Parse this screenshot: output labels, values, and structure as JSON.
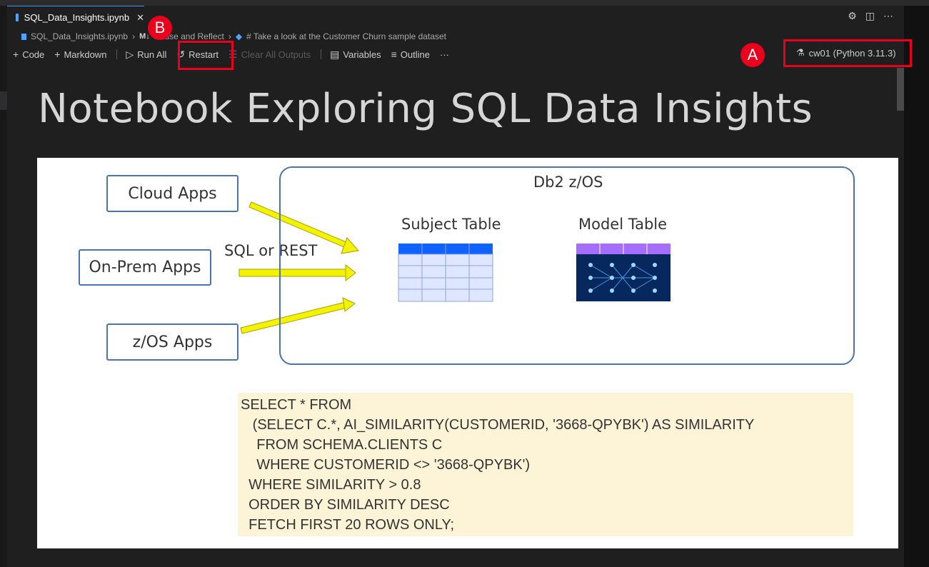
{
  "tab": {
    "title": "SQL_Data_Insights.ipynb",
    "close": "✕"
  },
  "top_icons": [
    "⚙",
    "◫",
    "⋯"
  ],
  "breadcrumb": {
    "file": "SQL_Data_Insights.ipynb",
    "markdown_badge": "M↓",
    "section": "Pause and Reflect",
    "cell": "# Take a look at the Customer Churn sample dataset"
  },
  "toolbar": {
    "code": "Code",
    "markdown": "Markdown",
    "run_all": "Run All",
    "restart": "Restart",
    "clear_outputs": "Clear All Outputs",
    "variables": "Variables",
    "outline": "Outline",
    "more": "···"
  },
  "kernel": {
    "label": "cw01 (Python 3.11.3)"
  },
  "annotations": {
    "a": "A",
    "b": "B"
  },
  "accent_color": "#e8001c",
  "notebook": {
    "heading": "Notebook Exploring SQL Data Insights"
  },
  "diagram": {
    "apps": [
      "Cloud Apps",
      "On-Prem Apps",
      "z/OS Apps"
    ],
    "connector_label": "SQL or REST",
    "container_label": "Db2 z/OS",
    "subject_table": "Subject Table",
    "model_table": "Model Table"
  },
  "sql_lines": [
    "SELECT * FROM",
    "   (SELECT C.*, AI_SIMILARITY(CUSTOMERID, '3668-QPYBK') AS SIMILARITY",
    "    FROM SCHEMA.CLIENTS C",
    "    WHERE CUSTOMERID <> '3668-QPYBK')",
    "  WHERE SIMILARITY > 0.8",
    "  ORDER BY SIMILARITY DESC",
    "  FETCH FIRST 20 ROWS ONLY;"
  ]
}
